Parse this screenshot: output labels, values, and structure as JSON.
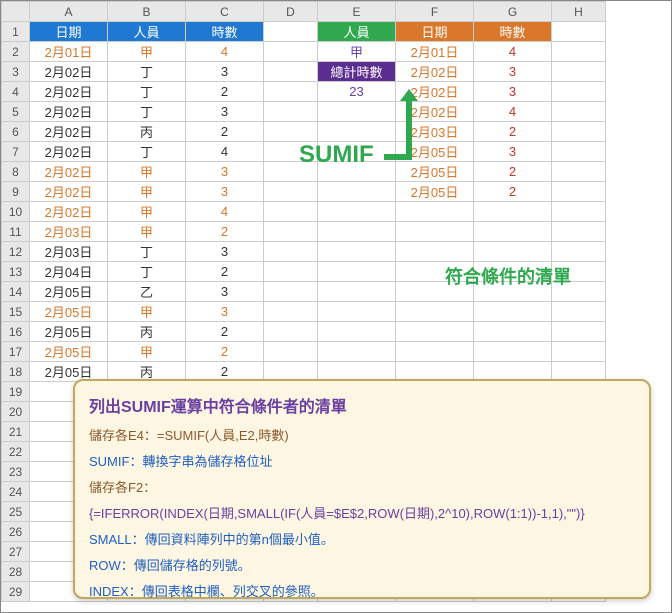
{
  "columns": [
    "A",
    "B",
    "C",
    "D",
    "E",
    "F",
    "G",
    "H"
  ],
  "headers_left": {
    "date": "日期",
    "person": "人員",
    "hours": "時數"
  },
  "headers_right": {
    "person": "人員",
    "date": "日期",
    "hours": "時數"
  },
  "total_label": "總計時數",
  "left_rows": [
    {
      "date": "2月01日",
      "person": "甲",
      "hours": "4",
      "hl": true
    },
    {
      "date": "2月02日",
      "person": "丁",
      "hours": "3",
      "hl": false
    },
    {
      "date": "2月02日",
      "person": "丁",
      "hours": "2",
      "hl": false
    },
    {
      "date": "2月02日",
      "person": "丁",
      "hours": "3",
      "hl": false
    },
    {
      "date": "2月02日",
      "person": "丙",
      "hours": "2",
      "hl": false
    },
    {
      "date": "2月02日",
      "person": "丁",
      "hours": "4",
      "hl": false
    },
    {
      "date": "2月02日",
      "person": "甲",
      "hours": "3",
      "hl": true
    },
    {
      "date": "2月02日",
      "person": "甲",
      "hours": "3",
      "hl": true
    },
    {
      "date": "2月02日",
      "person": "甲",
      "hours": "4",
      "hl": true
    },
    {
      "date": "2月03日",
      "person": "甲",
      "hours": "2",
      "hl": true
    },
    {
      "date": "2月03日",
      "person": "丁",
      "hours": "3",
      "hl": false
    },
    {
      "date": "2月04日",
      "person": "丁",
      "hours": "2",
      "hl": false
    },
    {
      "date": "2月05日",
      "person": "乙",
      "hours": "3",
      "hl": false
    },
    {
      "date": "2月05日",
      "person": "甲",
      "hours": "3",
      "hl": true
    },
    {
      "date": "2月05日",
      "person": "丙",
      "hours": "2",
      "hl": false
    },
    {
      "date": "2月05日",
      "person": "甲",
      "hours": "2",
      "hl": true
    },
    {
      "date": "2月05日",
      "person": "丙",
      "hours": "2",
      "hl": false
    }
  ],
  "right_person": "甲",
  "right_total": "23",
  "right_rows": [
    {
      "date": "2月01日",
      "hours": "4"
    },
    {
      "date": "2月02日",
      "hours": "3"
    },
    {
      "date": "2月02日",
      "hours": "3"
    },
    {
      "date": "2月02日",
      "hours": "4"
    },
    {
      "date": "2月03日",
      "hours": "2"
    },
    {
      "date": "2月05日",
      "hours": "3"
    },
    {
      "date": "2月05日",
      "hours": "2"
    },
    {
      "date": "2月05日",
      "hours": "2"
    }
  ],
  "sumif_label": "SUMIF",
  "filter_label": "符合條件的清單",
  "note": {
    "title": "列出SUMIF運算中符合條件者的清單",
    "l1": "儲存各E4：=SUMIF(人員,E2,時數)",
    "l2a": "SUMIF",
    "l2b": "：轉換字串為儲存格位址",
    "l3": "儲存各F2：",
    "l4": "{=IFERROR(INDEX(日期,SMALL(IF(人員=$E$2,ROW(日期),2^10),ROW(1:1))-1,1),\"\")}",
    "l5a": "SMALL",
    "l5b": "：傳回資料陣列中的第n個最小值。",
    "l6a": "ROW",
    "l6b": "：傳回儲存格的列號。",
    "l7a": "INDEX",
    "l7b": "：傳回表格中欄、列交叉的參照。"
  },
  "row_count": 29
}
